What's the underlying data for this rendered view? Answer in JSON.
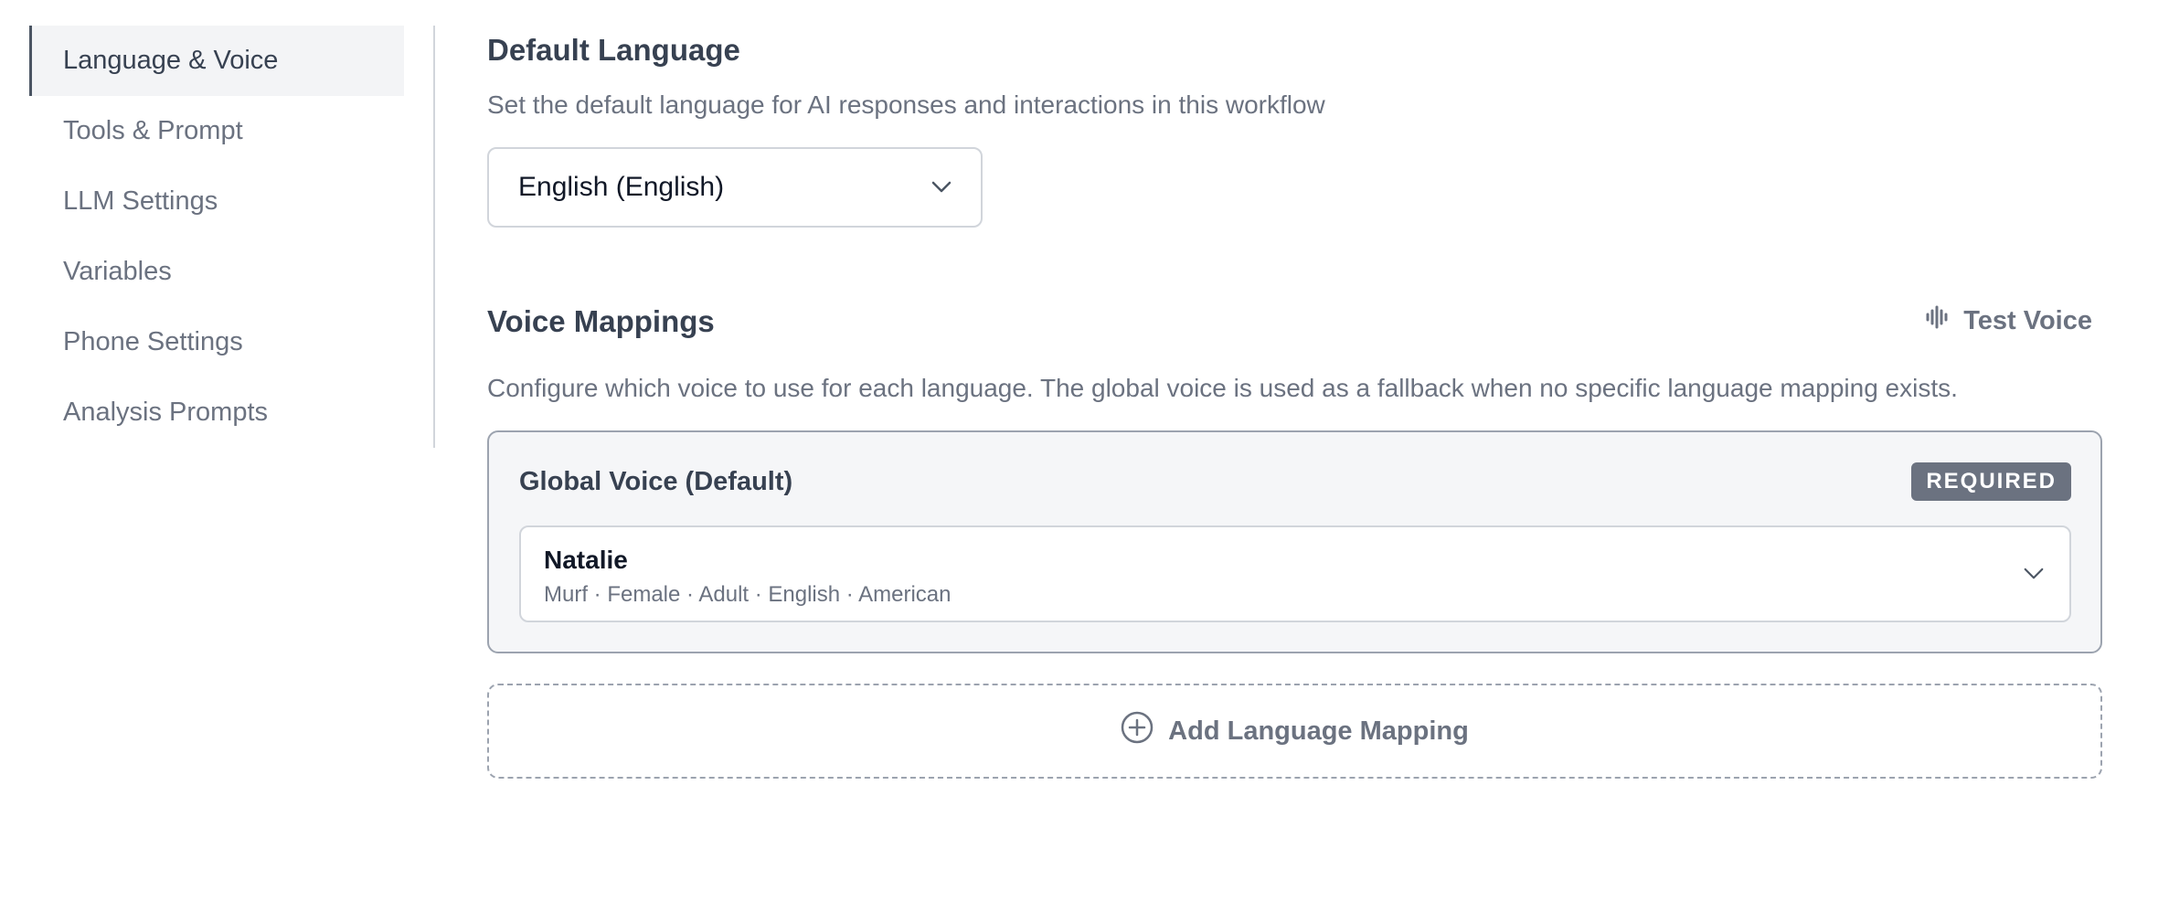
{
  "sidebar": {
    "items": [
      {
        "label": "Language & Voice",
        "active": true
      },
      {
        "label": "Tools & Prompt"
      },
      {
        "label": "LLM Settings"
      },
      {
        "label": "Variables"
      },
      {
        "label": "Phone Settings"
      },
      {
        "label": "Analysis Prompts"
      }
    ]
  },
  "default_language": {
    "title": "Default Language",
    "description": "Set the default language for AI responses and interactions in this workflow",
    "selected": "English (English)"
  },
  "voice_mappings": {
    "title": "Voice Mappings",
    "test_voice_label": "Test Voice",
    "description": "Configure which voice to use for each language. The global voice is used as a fallback when no specific language mapping exists.",
    "global_voice": {
      "title": "Global Voice (Default)",
      "badge": "REQUIRED",
      "voice_name": "Natalie",
      "voice_meta": "Murf · Female · Adult · English · American"
    },
    "add_mapping_label": "Add Language Mapping"
  },
  "icons": {
    "chevron": "chevron-down-icon",
    "waveform": "waveform-icon",
    "add": "plus-circle-icon"
  },
  "colors": {
    "text_primary": "#374151",
    "text_muted": "#6b7280",
    "badge_bg": "#6b7280",
    "card_bg": "#f5f6f8",
    "border": "#d1d5db"
  }
}
